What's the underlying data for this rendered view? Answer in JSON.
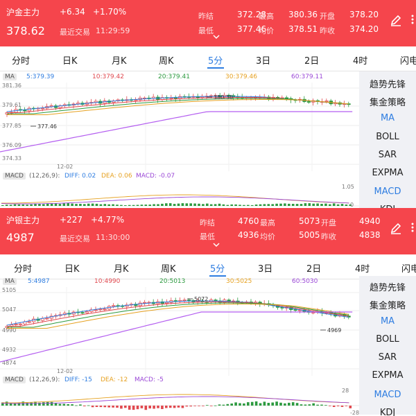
{
  "tabs": [
    "分时",
    "日K",
    "月K",
    "周K",
    "5分",
    "3日",
    "2日",
    "4时",
    "闪电"
  ],
  "active_tab": 4,
  "side_items": [
    "趋势先锋",
    "集金策略",
    "MA",
    "BOLL",
    "SAR",
    "EXPMA",
    "MACD",
    "KDJ"
  ],
  "colors": {
    "header_bg": "#f5454c",
    "up": "#e0484e",
    "down": "#2c9a3f",
    "accent": "#2e7de1"
  },
  "panels": [
    {
      "name": "沪金主力",
      "change": "+6.34",
      "change_pct": "+1.70%",
      "price": "378.62",
      "time_label": "最近交易",
      "time": "11:29:59",
      "stats": [
        [
          "昨结",
          "372.28"
        ],
        [
          "最高",
          "380.36"
        ],
        [
          "开盘",
          "378.20"
        ],
        [
          "最低",
          "377.46"
        ],
        [
          "均价",
          "378.51"
        ],
        [
          "昨收",
          "374.20"
        ]
      ],
      "ma_tag": "MA",
      "ma": [
        "5:379.39",
        "10:379.42",
        "20:379.41",
        "30:379.46",
        "60:379.11"
      ],
      "y_ticks": [
        "381.36",
        "379.61",
        "377.85",
        "376.09",
        "374.33"
      ],
      "date_label": "12-02",
      "high_label": "380.36",
      "low_label": "377.46",
      "macd_tag": "MACD",
      "macd_params": "(12,26,9):",
      "macd_values": [
        "DIFF: 0.02",
        "DEA: 0.06",
        "MACD: -0.07"
      ],
      "macd_max": "1.05",
      "macd_min": "0"
    },
    {
      "name": "沪银主力",
      "change": "+227",
      "change_pct": "+4.77%",
      "price": "4987",
      "time_label": "最近交易",
      "time": "11:30:00",
      "stats": [
        [
          "昨结",
          "4760"
        ],
        [
          "最高",
          "5073"
        ],
        [
          "开盘",
          "4940"
        ],
        [
          "最低",
          "4936"
        ],
        [
          "均价",
          "5005"
        ],
        [
          "昨收",
          "4838"
        ]
      ],
      "ma_tag": "MA",
      "ma": [
        "5:4987",
        "10:4990",
        "20:5013",
        "30:5025",
        "60:5030"
      ],
      "y_ticks": [
        "5105",
        "5047",
        "4990",
        "4932",
        "4874"
      ],
      "date_label": "12-02",
      "high_label": "5072",
      "low_label": "4969",
      "macd_tag": "MACD",
      "macd_params": "(12,26,9):",
      "macd_values": [
        "DIFF: -15",
        "DEA: -12",
        "MACD: -5"
      ],
      "macd_max": "28",
      "macd_min": "-28"
    }
  ]
}
